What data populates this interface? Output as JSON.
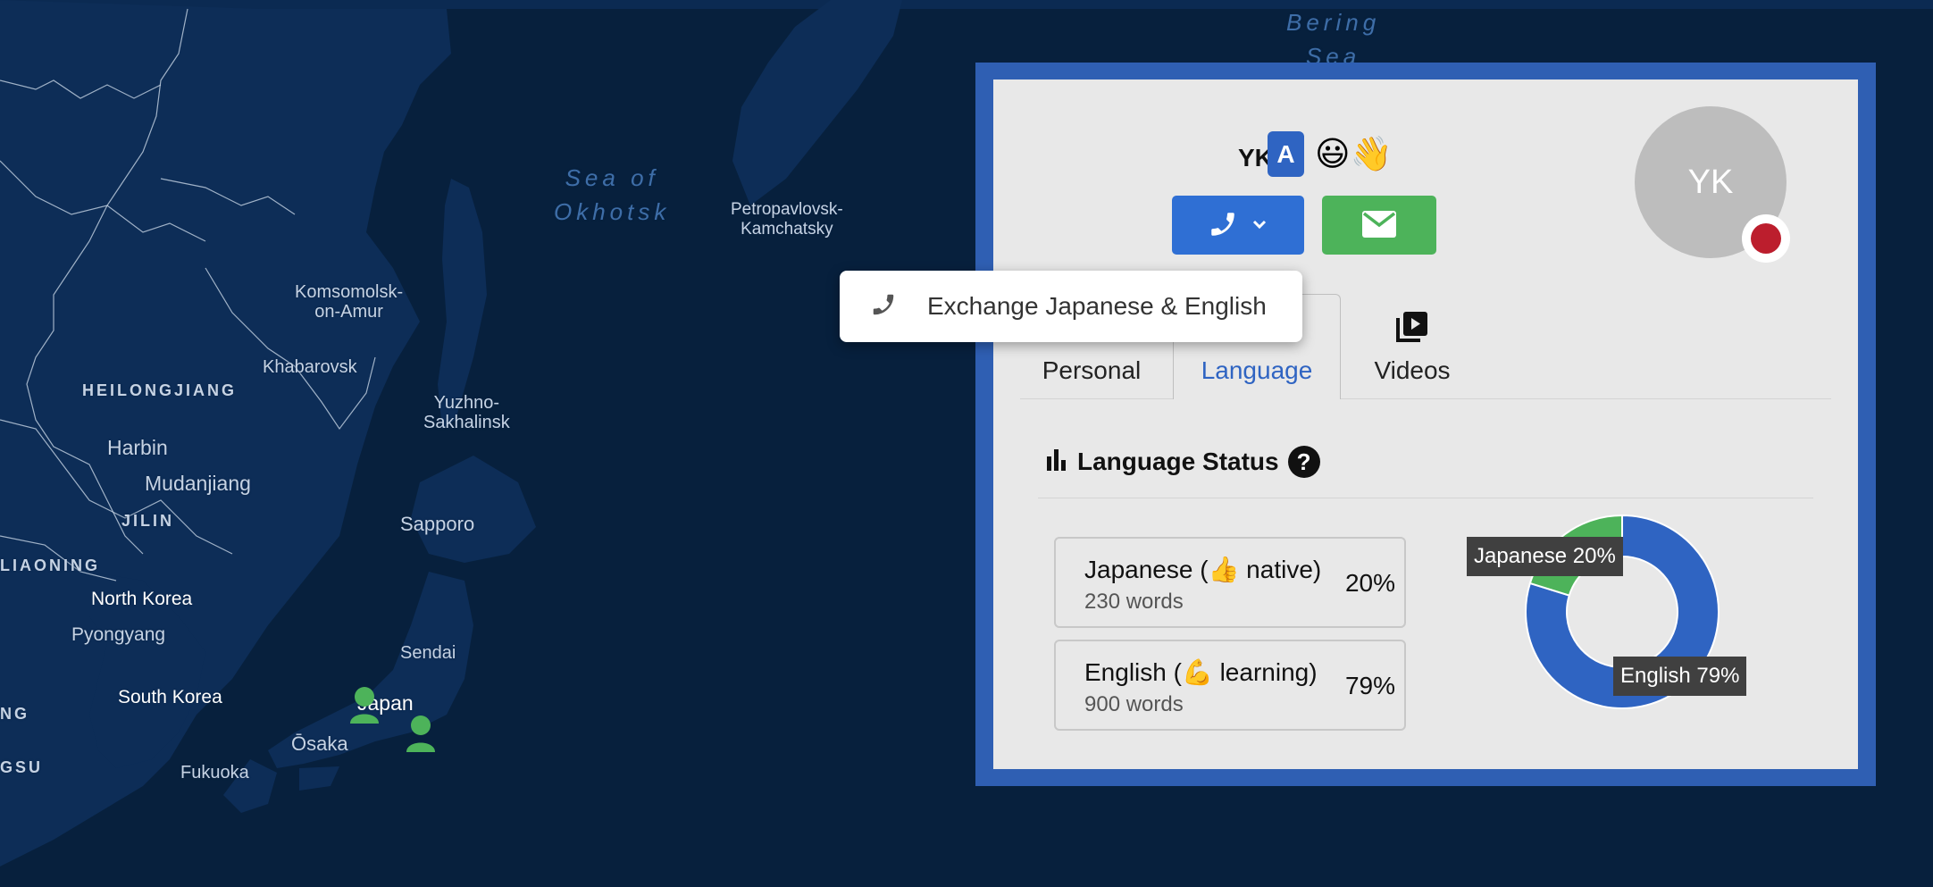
{
  "map": {
    "labels": [
      {
        "name": "map-label-bering-sea",
        "text": "Bering\nSea"
      },
      {
        "name": "map-label-sea-of-okhotsk",
        "text": "Sea of\nOkhotsk"
      },
      {
        "name": "map-label-petropavlovsk",
        "text": "Petropavlovsk-\nKamchatsky"
      },
      {
        "name": "map-label-komsomolsk",
        "text": "Komsomolsk-\non-Amur"
      },
      {
        "name": "map-label-khabarovsk",
        "text": "Khabarovsk"
      },
      {
        "name": "map-label-yuzhno",
        "text": "Yuzhno-\nSakhalinsk"
      },
      {
        "name": "map-label-heilongjiang",
        "text": "HEILONGJIANG"
      },
      {
        "name": "map-label-harbin",
        "text": "Harbin"
      },
      {
        "name": "map-label-mudanjiang",
        "text": "Mudanjiang"
      },
      {
        "name": "map-label-jilin",
        "text": "JILIN"
      },
      {
        "name": "map-label-liaoning",
        "text": "LIAONING"
      },
      {
        "name": "map-label-sapporo",
        "text": "Sapporo"
      },
      {
        "name": "map-label-north-korea",
        "text": "North Korea"
      },
      {
        "name": "map-label-pyongyang",
        "text": "Pyongyang"
      },
      {
        "name": "map-label-sendai",
        "text": "Sendai"
      },
      {
        "name": "map-label-south-korea",
        "text": "South Korea"
      },
      {
        "name": "map-label-japan",
        "text": "Japan"
      },
      {
        "name": "map-label-osaka",
        "text": "Ōsaka"
      },
      {
        "name": "map-label-fukuoka",
        "text": "Fukuoka"
      },
      {
        "name": "map-label-ng",
        "text": "NG"
      },
      {
        "name": "map-label-gsu",
        "text": "GSU"
      }
    ],
    "pin_color": "#4db35a"
  },
  "profile": {
    "initials": "YK",
    "level_badge": "A",
    "emojis": "😃👋",
    "avatar_initials": "YK",
    "flag_color": "#bc1e2d"
  },
  "tabs": [
    {
      "label": "Personal",
      "icon": "user-icon"
    },
    {
      "label": "Language",
      "icon": "language-icon",
      "active": true
    },
    {
      "label": "Videos",
      "icon": "video-icon"
    }
  ],
  "language_status": {
    "title": "Language Status",
    "help": "?",
    "languages": [
      {
        "name": "Japanese (👍 native)",
        "words": "230 words",
        "percent": "20%"
      },
      {
        "name": "English (💪 learning)",
        "words": "900 words",
        "percent": "79%"
      }
    ]
  },
  "chart_data": {
    "type": "pie",
    "categories": [
      "Japanese",
      "English"
    ],
    "values": [
      20,
      79
    ],
    "labels": [
      "Japanese 20%",
      "English 79%"
    ],
    "colors": [
      "#4db35a",
      "#2f64c2"
    ],
    "title": ""
  },
  "popup": {
    "text": "Exchange Japanese & English",
    "icon": "phone-icon"
  },
  "colors": {
    "panel_border": "#2f5fb3",
    "call_button": "#2f6fd4",
    "mail_button": "#4db35a",
    "map_background": "#07203d"
  }
}
